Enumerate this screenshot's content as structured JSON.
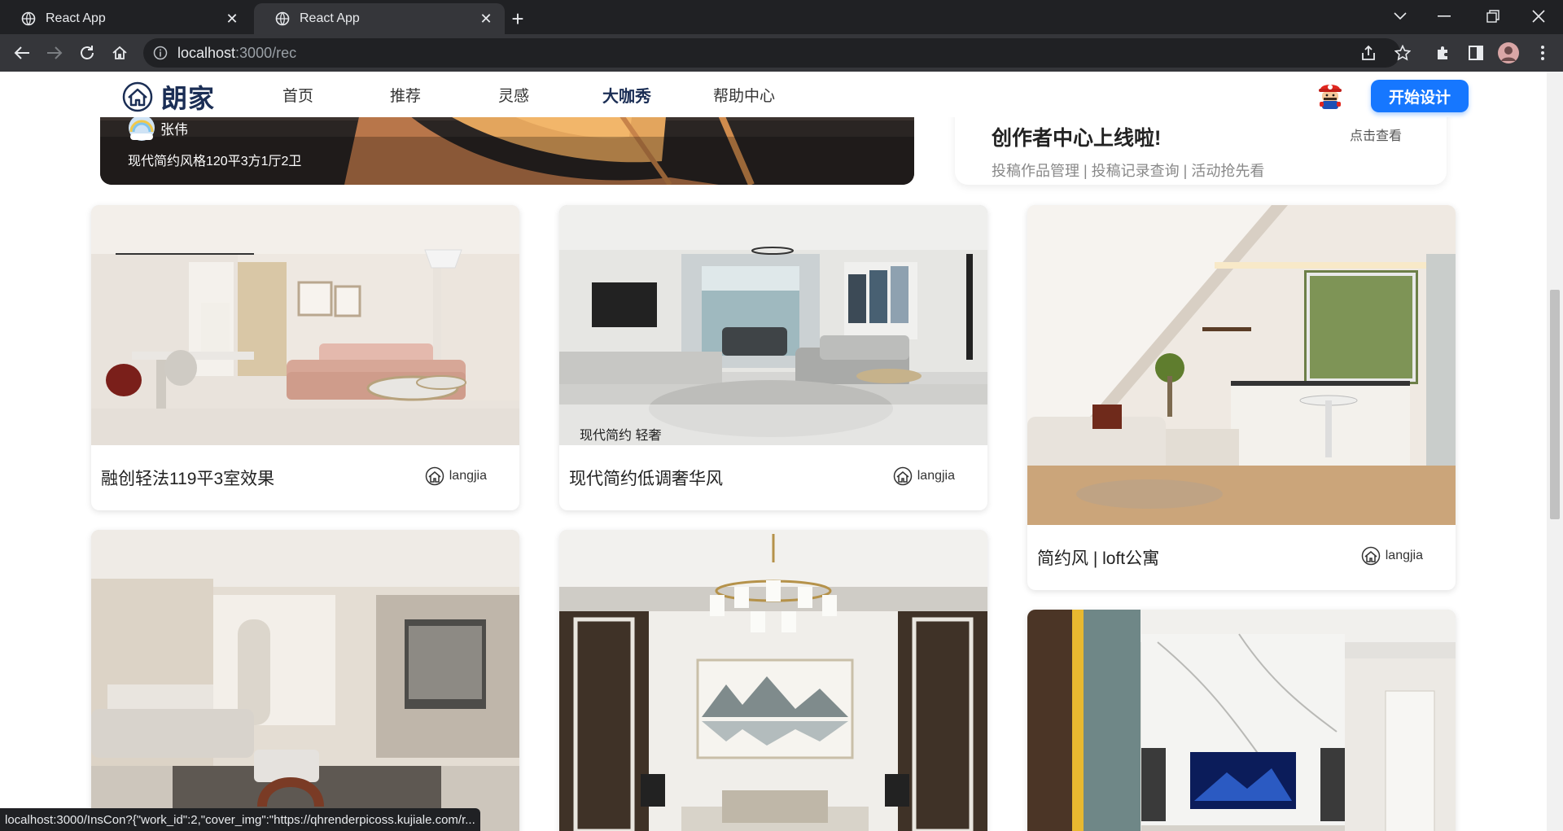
{
  "browser": {
    "tabs": [
      {
        "title": "React App",
        "active": false
      },
      {
        "title": "React App",
        "active": true
      }
    ],
    "url_host": "localhost",
    "url_path": ":3000/rec",
    "status_url": "localhost:3000/InsCon?{\"work_id\":2,\"cover_img\":\"https://qhrenderpicoss.kujiale.com/r..."
  },
  "header": {
    "logo_text": "朗家",
    "nav": [
      "首页",
      "推荐",
      "灵感",
      "大咖秀",
      "帮助中心"
    ],
    "active_nav": "大咖秀",
    "start_button": "开始设计"
  },
  "banner": {
    "user_name": "张伟",
    "description": "现代简约风格120平3方1厅2卫"
  },
  "creator": {
    "title": "创作者中心上线啦!",
    "link": "点击查看",
    "subtitle": "投稿作品管理 | 投稿记录查询 | 活动抢先看"
  },
  "cards": [
    {
      "title": "融创轻法119平3室效果",
      "author": "langjia",
      "tag": ""
    },
    {
      "title": "现代简约低调奢华风",
      "author": "langjia",
      "tag": "现代简约 轻奢"
    },
    {
      "title": "简约风 | loft公寓",
      "author": "langjia",
      "tag": ""
    },
    {
      "title": "",
      "author": "",
      "tag": ""
    },
    {
      "title": "",
      "author": "",
      "tag": ""
    },
    {
      "title": "",
      "author": "",
      "tag": ""
    }
  ],
  "colors": {
    "brand": "#1b2e55",
    "button": "#1677ff",
    "chrome_dark": "#202124",
    "chrome_mid": "#35363a"
  }
}
